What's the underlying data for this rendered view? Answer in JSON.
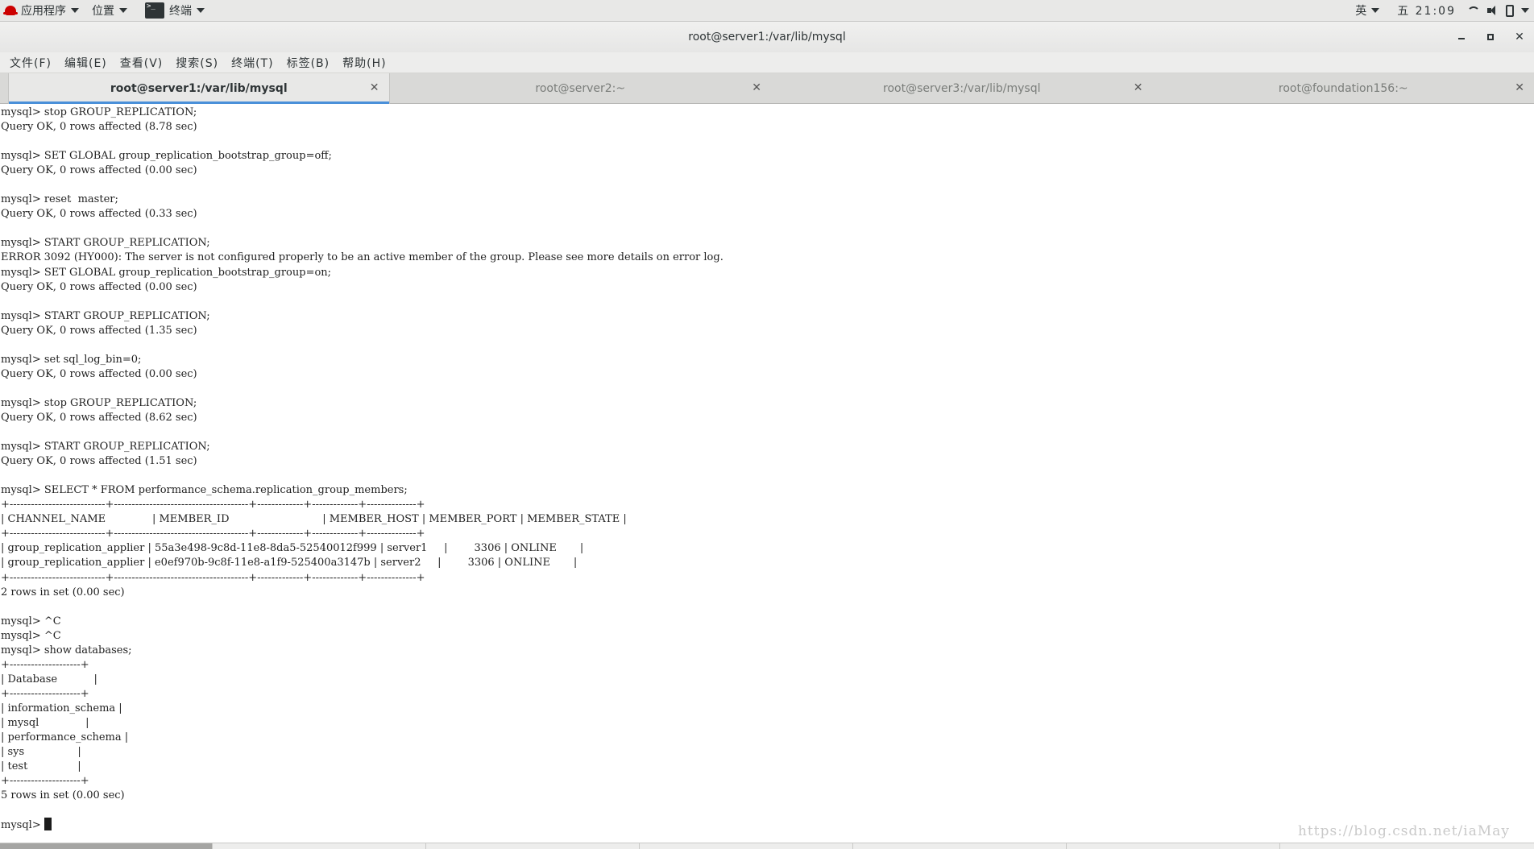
{
  "topbar": {
    "apps_label": "应用程序",
    "places_label": "位置",
    "terminal_label": "终端",
    "input_method": "英",
    "clock": "五 21:09"
  },
  "window": {
    "title": "root@server1:/var/lib/mysql"
  },
  "menu": [
    {
      "label": "文件(F)"
    },
    {
      "label": "编辑(E)"
    },
    {
      "label": "查看(V)"
    },
    {
      "label": "搜索(S)"
    },
    {
      "label": "终端(T)"
    },
    {
      "label": "标签(B)"
    },
    {
      "label": "帮助(H)"
    }
  ],
  "tabs": [
    {
      "label": "root@server1:/var/lib/mysql",
      "active": true
    },
    {
      "label": "root@server2:~",
      "active": false
    },
    {
      "label": "root@server3:/var/lib/mysql",
      "active": false
    },
    {
      "label": "root@foundation156:~",
      "active": false
    }
  ],
  "terminal": {
    "lines": [
      "mysql> stop GROUP_REPLICATION;",
      "Query OK, 0 rows affected (8.78 sec)",
      "",
      "mysql> SET GLOBAL group_replication_bootstrap_group=off;",
      "Query OK, 0 rows affected (0.00 sec)",
      "",
      "mysql> reset  master;",
      "Query OK, 0 rows affected (0.33 sec)",
      "",
      "mysql> START GROUP_REPLICATION;",
      "ERROR 3092 (HY000): The server is not configured properly to be an active member of the group. Please see more details on error log.",
      "mysql> SET GLOBAL group_replication_bootstrap_group=on;",
      "Query OK, 0 rows affected (0.00 sec)",
      "",
      "mysql> START GROUP_REPLICATION;",
      "Query OK, 0 rows affected (1.35 sec)",
      "",
      "mysql> set sql_log_bin=0;",
      "Query OK, 0 rows affected (0.00 sec)",
      "",
      "mysql> stop GROUP_REPLICATION;",
      "Query OK, 0 rows affected (8.62 sec)",
      "",
      "mysql> START GROUP_REPLICATION;",
      "Query OK, 0 rows affected (1.51 sec)",
      "",
      "mysql> SELECT * FROM performance_schema.replication_group_members;",
      "+---------------------------+--------------------------------------+-------------+-------------+--------------+",
      "| CHANNEL_NAME              | MEMBER_ID                            | MEMBER_HOST | MEMBER_PORT | MEMBER_STATE |",
      "+---------------------------+--------------------------------------+-------------+-------------+--------------+",
      "| group_replication_applier | 55a3e498-9c8d-11e8-8da5-52540012f999 | server1     |        3306 | ONLINE       |",
      "| group_replication_applier | e0ef970b-9c8f-11e8-a1f9-525400a3147b | server2     |        3306 | ONLINE       |",
      "+---------------------------+--------------------------------------+-------------+-------------+--------------+",
      "2 rows in set (0.00 sec)",
      "",
      "mysql> ^C",
      "mysql> ^C",
      "mysql> show databases;",
      "+--------------------+",
      "| Database           |",
      "+--------------------+",
      "| information_schema |",
      "| mysql              |",
      "| performance_schema |",
      "| sys                |",
      "| test               |",
      "+--------------------+",
      "5 rows in set (0.00 sec)",
      "",
      "mysql> "
    ]
  },
  "watermark": "https://blog.csdn.net/iaMay"
}
